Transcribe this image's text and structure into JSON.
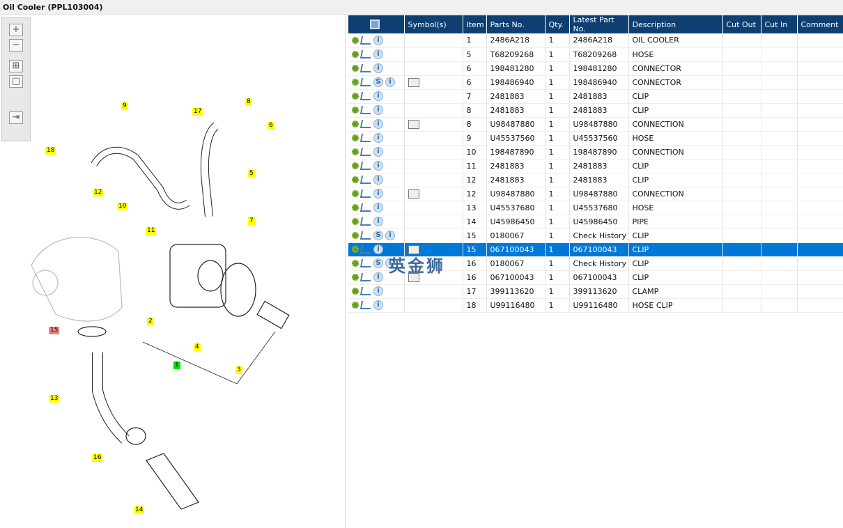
{
  "title": "Oil Cooler (PPL103004)",
  "toolbar": [
    "zoom-in",
    "zoom-out",
    "fit",
    "actual-size",
    "list-view"
  ],
  "labels": [
    "9",
    "17",
    "8",
    "6",
    "18",
    "5",
    "12",
    "10",
    "11",
    "7",
    "2",
    "15",
    "4",
    "1",
    "3",
    "13",
    "16",
    "14"
  ],
  "columns": [
    "",
    "Symbol(s)",
    "Item",
    "Parts No.",
    "Qty.",
    "Latest Part No.",
    "Description",
    "Cut Out",
    "Cut In",
    "Comment"
  ],
  "rows": [
    {
      "icons": [
        "gears",
        "cart",
        "info"
      ],
      "sym": false,
      "item": "1",
      "part": "2486A218",
      "qty": "1",
      "latest": "2486A218",
      "desc": "OIL COOLER"
    },
    {
      "icons": [
        "gear",
        "cart",
        "info"
      ],
      "sym": false,
      "item": "5",
      "part": "T68209268",
      "qty": "1",
      "latest": "T68209268",
      "desc": "HOSE"
    },
    {
      "icons": [
        "gear",
        "cart",
        "info"
      ],
      "sym": false,
      "item": "6",
      "part": "198481280",
      "qty": "1",
      "latest": "198481280",
      "desc": "CONNECTOR"
    },
    {
      "icons": [
        "gear",
        "cart",
        "s",
        "info"
      ],
      "sym": true,
      "item": "6",
      "part": "198486940",
      "qty": "1",
      "latest": "198486940",
      "desc": "CONNECTOR"
    },
    {
      "icons": [
        "gear",
        "cart",
        "info"
      ],
      "sym": false,
      "item": "7",
      "part": "2481883",
      "qty": "1",
      "latest": "2481883",
      "desc": "CLIP"
    },
    {
      "icons": [
        "gear",
        "cart",
        "info"
      ],
      "sym": false,
      "item": "8",
      "part": "2481883",
      "qty": "1",
      "latest": "2481883",
      "desc": "CLIP"
    },
    {
      "icons": [
        "gear",
        "cart",
        "info"
      ],
      "sym": true,
      "item": "8",
      "part": "U98487880",
      "qty": "1",
      "latest": "U98487880",
      "desc": "CONNECTION"
    },
    {
      "icons": [
        "gear",
        "cart",
        "info"
      ],
      "sym": false,
      "item": "9",
      "part": "U45537560",
      "qty": "1",
      "latest": "U45537560",
      "desc": "HOSE"
    },
    {
      "icons": [
        "gear",
        "cart",
        "info"
      ],
      "sym": false,
      "item": "10",
      "part": "198487890",
      "qty": "1",
      "latest": "198487890",
      "desc": "CONNECTION"
    },
    {
      "icons": [
        "gear",
        "cart",
        "info"
      ],
      "sym": false,
      "item": "11",
      "part": "2481883",
      "qty": "1",
      "latest": "2481883",
      "desc": "CLIP"
    },
    {
      "icons": [
        "gear",
        "cart",
        "info"
      ],
      "sym": false,
      "item": "12",
      "part": "2481883",
      "qty": "1",
      "latest": "2481883",
      "desc": "CLIP"
    },
    {
      "icons": [
        "gear",
        "cart",
        "info"
      ],
      "sym": true,
      "item": "12",
      "part": "U98487880",
      "qty": "1",
      "latest": "U98487880",
      "desc": "CONNECTION"
    },
    {
      "icons": [
        "gear",
        "cart",
        "info"
      ],
      "sym": false,
      "item": "13",
      "part": "U45537680",
      "qty": "1",
      "latest": "U45537680",
      "desc": "HOSE"
    },
    {
      "icons": [
        "gear",
        "cart",
        "info"
      ],
      "sym": false,
      "item": "14",
      "part": "U45986450",
      "qty": "1",
      "latest": "U45986450",
      "desc": "PIPE"
    },
    {
      "icons": [
        "gear",
        "cart",
        "s",
        "info"
      ],
      "sym": false,
      "item": "15",
      "part": "0180067",
      "qty": "1",
      "latest": "Check History",
      "desc": "CLIP"
    },
    {
      "icons": [
        "gear",
        "cart",
        "info"
      ],
      "sym": true,
      "item": "15",
      "part": "067100043",
      "qty": "1",
      "latest": "067100043",
      "desc": "CLIP",
      "selected": true
    },
    {
      "icons": [
        "gear",
        "cart",
        "s",
        "info"
      ],
      "sym": false,
      "item": "16",
      "part": "0180067",
      "qty": "1",
      "latest": "Check History",
      "desc": "CLIP"
    },
    {
      "icons": [
        "gear",
        "cart",
        "info"
      ],
      "sym": true,
      "item": "16",
      "part": "067100043",
      "qty": "1",
      "latest": "067100043",
      "desc": "CLIP"
    },
    {
      "icons": [
        "gear",
        "cart",
        "info"
      ],
      "sym": false,
      "item": "17",
      "part": "399113620",
      "qty": "1",
      "latest": "399113620",
      "desc": "CLAMP"
    },
    {
      "icons": [
        "gear",
        "cart",
        "info"
      ],
      "sym": false,
      "item": "18",
      "part": "U99116480",
      "qty": "1",
      "latest": "U99116480",
      "desc": "HOSE CLIP"
    }
  ],
  "watermark": "英金狮"
}
